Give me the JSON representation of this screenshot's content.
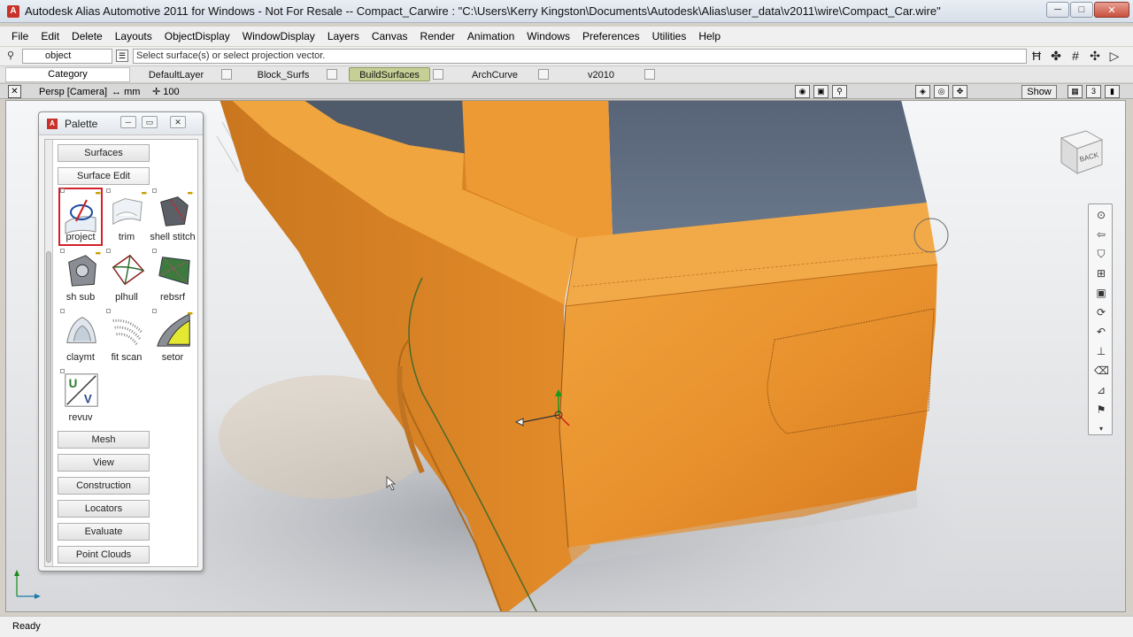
{
  "window": {
    "title": "Autodesk Alias Automotive 2011  for Windows - Not For Resale  --  Compact_Carwire : \"C:\\Users\\Kerry Kingston\\Documents\\Autodesk\\Alias\\user_data\\v2011\\wire\\Compact_Car.wire\"",
    "minimize": "─",
    "maximize": "□",
    "close": "✕"
  },
  "menu": [
    "File",
    "Edit",
    "Delete",
    "Layouts",
    "ObjectDisplay",
    "WindowDisplay",
    "Layers",
    "Canvas",
    "Render",
    "Animation",
    "Windows",
    "Preferences",
    "Utilities",
    "Help"
  ],
  "command": {
    "mode_value": "object",
    "prompt": "Select surface(s) or select projection vector."
  },
  "layers": {
    "category_label": "Category",
    "items": [
      {
        "name": "DefaultLayer",
        "active": false
      },
      {
        "name": "Block_Surfs",
        "active": false
      },
      {
        "name": "BuildSurfaces",
        "active": true
      },
      {
        "name": "ArchCurve",
        "active": false
      },
      {
        "name": "v2010",
        "active": false
      }
    ],
    "active_color": "#c6cf95"
  },
  "viewport": {
    "camera": "Persp [Camera]",
    "units": "mm",
    "grid": "100",
    "show_label": "Show",
    "layout_number": "3"
  },
  "palette": {
    "title": "Palette",
    "sections": {
      "surfaces": "Surfaces",
      "surface_edit": "Surface Edit",
      "mesh": "Mesh",
      "view": "View",
      "construction": "Construction",
      "locators": "Locators",
      "evaluate": "Evaluate",
      "point_clouds": "Point Clouds"
    },
    "tools": [
      "project",
      "trim",
      "shell stitch",
      "sh sub",
      "plhull",
      "rebsrf",
      "claymt",
      "fit scan",
      "setor",
      "revuv"
    ]
  },
  "viewcube_label": "BACK",
  "status": "Ready",
  "colors": {
    "car_body": "#e8922e",
    "glass": "#5f6e82",
    "selection": "#d3202a",
    "curve": "#4a6a2a"
  }
}
